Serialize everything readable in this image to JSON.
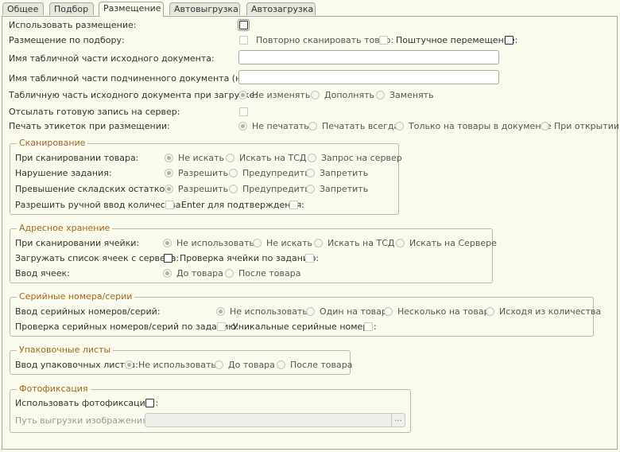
{
  "tabs": [
    "Общее",
    "Подбор",
    "Размещение",
    "Автовыгрузка",
    "Автозагрузка"
  ],
  "active_tab": "Размещение",
  "top": {
    "use_placement": "Использовать размещение:",
    "placement_by_pick": "Размещение по подбору:",
    "rescan": "Повторно сканировать товар:",
    "piece_move": "Поштучное перемещение:",
    "source_table_name": "Имя табличной части исходного документа:",
    "sub_table_name": "Имя табличной части подчиненного документа (нового):",
    "source_table_on_load": "Табличную часть исходного документа при загрузке:",
    "source_table_options": [
      "Не изменять",
      "Дополнять",
      "Заменять"
    ],
    "send_ready": "Отсылать готовую запись на сервер:",
    "print_labels": "Печать этикеток при размещении:",
    "print_options": [
      "Не печатать",
      "Печатать всегда",
      "Только на товары в документе",
      "При открытии"
    ]
  },
  "scan_group": {
    "title": "Сканирование",
    "on_scan": "При сканировании товара:",
    "on_scan_options": [
      "Не искать",
      "Искать на ТСД",
      "Запрос на сервер"
    ],
    "violation": "Нарушение задания:",
    "violation_options": [
      "Разрешить",
      "Предупредить",
      "Запретить"
    ],
    "overstock": "Превышение складских остатков:",
    "overstock_options": [
      "Разрешить",
      "Предупредить",
      "Запретить"
    ],
    "manual_qty": "Разрешить ручной ввод количества:",
    "enter_confirm": "Enter для подтверждения:"
  },
  "address_group": {
    "title": "Адресное хранение",
    "on_cell_scan": "При сканировании ячейки:",
    "cell_scan_options": [
      "Не использовать",
      "Не искать",
      "Искать на ТСД",
      "Искать на Сервере"
    ],
    "load_cells": "Загружать список ячеек с сервера:",
    "check_cell": "Проверка ячейки по заданию:",
    "cell_input": "Ввод ячеек:",
    "cell_input_options": [
      "До товара",
      "После товара"
    ]
  },
  "serial_group": {
    "title": "Серийные номера/серии",
    "serial_input": "Ввод серийных номеров/серий:",
    "serial_options": [
      "Не использовать",
      "Один на товар",
      "Несколько на товар",
      "Исходя из количества"
    ],
    "serial_check": "Проверка серийных номеров/серий по заданию:",
    "unique": "Уникальные серийные номера:"
  },
  "pack_group": {
    "title": "Упаковочные листы",
    "pack_input": "Ввод упаковочных листов:",
    "pack_options": [
      "Не использовать",
      "До товара",
      "После товара"
    ]
  },
  "photo_group": {
    "title": "Фотофиксация",
    "use_photo": "Использовать фотофиксацию :",
    "path": "Путь выгрузки изображения :",
    "path_button": "..."
  }
}
